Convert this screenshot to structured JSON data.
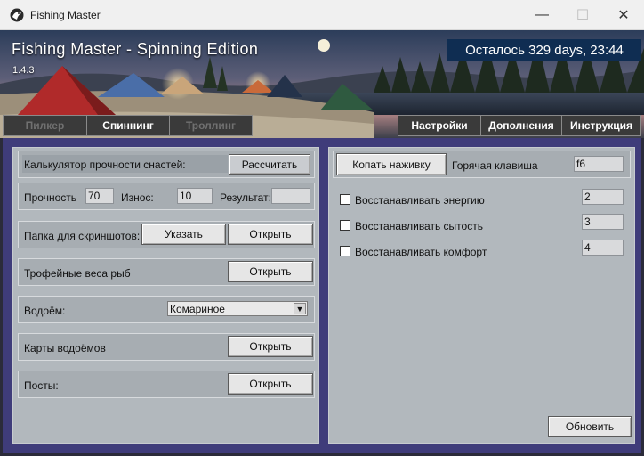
{
  "window": {
    "title": "Fishing Master",
    "minimize_glyph": "—",
    "maximize_glyph": "☐",
    "close_glyph": "✕"
  },
  "banner": {
    "app_name": "Fishing Master - Spinning Edition",
    "version": "1.4.3",
    "countdown": "Осталось 329 days, 23:44"
  },
  "tabs_left": [
    {
      "label": "Пилкер",
      "state": "disabled"
    },
    {
      "label": "Спиннинг",
      "state": "active"
    },
    {
      "label": "Троллинг",
      "state": "disabled"
    }
  ],
  "tabs_right": [
    {
      "label": "Настройки"
    },
    {
      "label": "Дополнения"
    },
    {
      "label": "Инструкция"
    }
  ],
  "left": {
    "calculator": {
      "label": "Калькулятор прочности снастей:",
      "button": "Рассчитать"
    },
    "durability": {
      "strength_label": "Прочность",
      "strength_value": "70",
      "wear_label": "Износ:",
      "wear_value": "10",
      "result_label": "Результат:",
      "result_value": ""
    },
    "screenshots": {
      "label": "Папка для скриншотов:",
      "set_button": "Указать",
      "open_button": "Открыть"
    },
    "trophy": {
      "label": "Трофейные веса рыб",
      "open_button": "Открыть"
    },
    "water": {
      "label": "Водоём:",
      "selected": "Комариное"
    },
    "maps": {
      "label": "Карты водоёмов",
      "open_button": "Открыть"
    },
    "posts": {
      "label": "Посты:",
      "open_button": "Открыть"
    }
  },
  "right": {
    "dig_button": "Копать наживку",
    "hotkey_label": "Горячая клавиша",
    "hotkey_value": "f6",
    "options": [
      {
        "label": "Восстанавливать энергию",
        "value": "2",
        "checked": false
      },
      {
        "label": "Восстанавливать сытость",
        "value": "3",
        "checked": false
      },
      {
        "label": "Восстанавливать комфорт",
        "value": "4",
        "checked": false
      }
    ],
    "refresh_button": "Обновить"
  },
  "colors": {
    "accent_countdown": "#0f2d52",
    "main_bg": "#3f3c7a",
    "panel_bg": "#b2b8bd",
    "tab_dark": "#3a3a3a"
  }
}
